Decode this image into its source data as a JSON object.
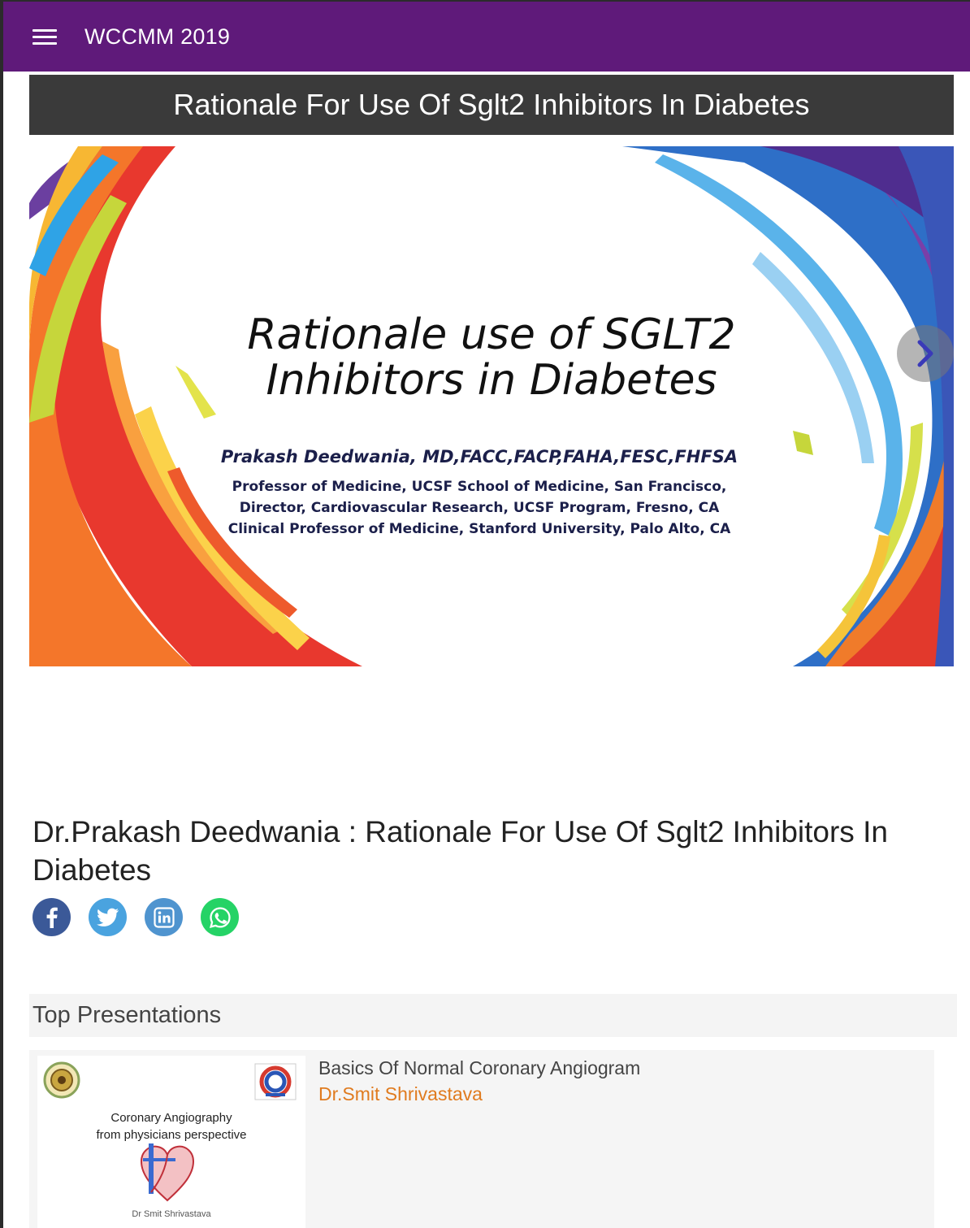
{
  "app": {
    "title": "WCCMM 2019"
  },
  "presentation": {
    "heading": "Rationale For Use Of Sglt2 Inhibitors In Diabetes",
    "slide": {
      "title_line1": "Rationale use of SGLT2",
      "title_line2": "Inhibitors in Diabetes",
      "author": "Prakash Deedwania, MD,FACC,FACP,FAHA,FESC,FHFSA",
      "affiliation_line1": "Professor of Medicine, UCSF School of Medicine, San Francisco,",
      "affiliation_line2": "Director, Cardiovascular Research, UCSF Program, Fresno, CA",
      "affiliation_line3": "Clinical Professor of Medicine, Stanford University, Palo Alto, CA"
    },
    "full_title": "Dr.Prakash Deedwania : Rationale For Use Of Sglt2 Inhibitors In Diabetes"
  },
  "share": {
    "icons": [
      "facebook-icon",
      "twitter-icon",
      "linkedin-icon",
      "whatsapp-icon"
    ],
    "colors": {
      "facebook": "#3b5998",
      "twitter": "#4aa3df",
      "linkedin": "#4f94cf",
      "whatsapp": "#25d366"
    }
  },
  "top_presentations": {
    "heading": "Top Presentations",
    "items": [
      {
        "title": "Basics Of Normal Coronary Angiogram",
        "author": "Dr.Smit Shrivastava",
        "thumb_line1": "Coronary Angiography",
        "thumb_line2": "from physicians perspective",
        "thumb_author": "Dr Smit Shrivastava"
      }
    ]
  },
  "colors": {
    "appbar": "#5f1a7a",
    "heading_strip": "#3a3a3a",
    "author_link": "#e07b1f"
  }
}
